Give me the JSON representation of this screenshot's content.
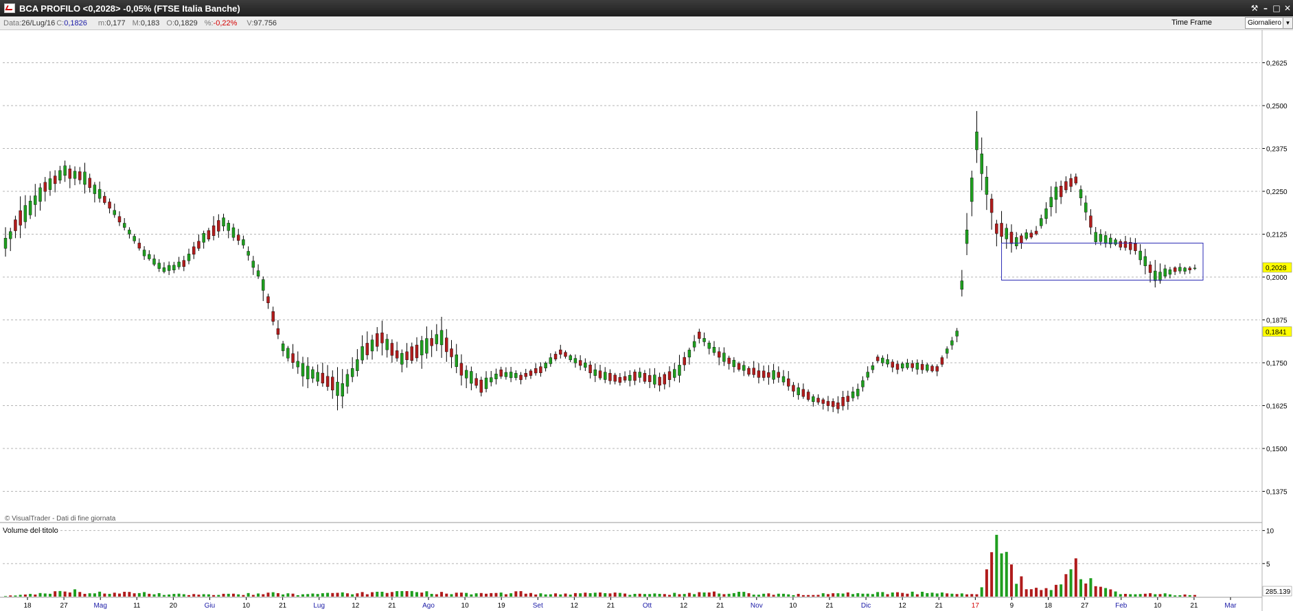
{
  "window": {
    "title": "BCA PROFILO <0,2028> -0,05%  (FTSE Italia Banche)",
    "controls": [
      "tool",
      "minimize",
      "maximize",
      "close"
    ]
  },
  "infobar": {
    "date_label": "Data:",
    "date_value": "26/Lug/16",
    "close_label": "C:",
    "close_value": "0,1826",
    "min_label": "m:",
    "min_value": "0,177",
    "max_label": "M:",
    "max_value": "0,183",
    "open_label": "O:",
    "open_value": "0,1829",
    "pct_label": "%:",
    "pct_value": "-0,22%",
    "vol_label": "V:",
    "vol_value": "97.756",
    "timeframe_label": "Time Frame",
    "timeframe_value": "Giornaliero"
  },
  "colors": {
    "up": "#1f9e1f",
    "down": "#b01c1c",
    "wick": "#000000",
    "grid": "#b4b4b4",
    "highlight_box": "#2a2ab4",
    "price_tag": "#ffff00",
    "month_label": "#1a1aa6",
    "highlight_label": "#d40000"
  },
  "chart": {
    "watermark": "© VisualTrader - Dati di fine giornata",
    "volume_title": "Volume del titolo",
    "price_axis": [
      "0,2625",
      "0,2500",
      "0,2375",
      "0,2250",
      "0,2125",
      "0,2000",
      "0,1875",
      "0,1750",
      "0,1625",
      "0,1500",
      "0,1375"
    ],
    "volume_axis": [
      "10",
      "5"
    ],
    "volume_value_tag": "285.139",
    "last_price_tag": "0,2028",
    "second_price_tag": "0,1841"
  },
  "chart_data": {
    "type": "candlestick",
    "symbol": "BCA PROFILO",
    "ylim": [
      0.13,
      0.27
    ],
    "volume_ylim": [
      0,
      11
    ],
    "x_ticks": [
      {
        "label": "18",
        "kind": "day"
      },
      {
        "label": "27",
        "kind": "day"
      },
      {
        "label": "Mag",
        "kind": "month"
      },
      {
        "label": "11",
        "kind": "day"
      },
      {
        "label": "20",
        "kind": "day"
      },
      {
        "label": "Giu",
        "kind": "month"
      },
      {
        "label": "10",
        "kind": "day"
      },
      {
        "label": "21",
        "kind": "day"
      },
      {
        "label": "Lug",
        "kind": "month"
      },
      {
        "label": "12",
        "kind": "day"
      },
      {
        "label": "21",
        "kind": "day"
      },
      {
        "label": "Ago",
        "kind": "month"
      },
      {
        "label": "10",
        "kind": "day"
      },
      {
        "label": "19",
        "kind": "day"
      },
      {
        "label": "Set",
        "kind": "month"
      },
      {
        "label": "12",
        "kind": "day"
      },
      {
        "label": "21",
        "kind": "day"
      },
      {
        "label": "Ott",
        "kind": "month"
      },
      {
        "label": "12",
        "kind": "day"
      },
      {
        "label": "21",
        "kind": "day"
      },
      {
        "label": "Nov",
        "kind": "month"
      },
      {
        "label": "10",
        "kind": "day"
      },
      {
        "label": "21",
        "kind": "day"
      },
      {
        "label": "Dic",
        "kind": "month"
      },
      {
        "label": "12",
        "kind": "day"
      },
      {
        "label": "21",
        "kind": "day"
      },
      {
        "label": "17",
        "kind": "highlight"
      },
      {
        "label": "9",
        "kind": "day"
      },
      {
        "label": "18",
        "kind": "day"
      },
      {
        "label": "27",
        "kind": "day"
      },
      {
        "label": "Feb",
        "kind": "month"
      },
      {
        "label": "10",
        "kind": "day"
      },
      {
        "label": "21",
        "kind": "day"
      },
      {
        "label": "Mar",
        "kind": "month"
      }
    ],
    "anchors": [
      [
        0.208,
        0.212
      ],
      [
        0.216,
        0.222
      ],
      [
        0.224,
        0.228
      ],
      [
        0.229,
        0.233
      ],
      [
        0.227,
        0.231
      ],
      [
        0.221,
        0.224
      ],
      [
        0.214,
        0.216
      ],
      [
        0.206,
        0.208
      ],
      [
        0.201,
        0.203
      ],
      [
        0.203,
        0.205
      ],
      [
        0.21,
        0.213
      ],
      [
        0.214,
        0.218
      ],
      [
        0.209,
        0.211
      ],
      [
        0.196,
        0.2
      ],
      [
        0.178,
        0.181
      ],
      [
        0.171,
        0.175
      ],
      [
        0.168,
        0.172
      ],
      [
        0.164,
        0.17
      ],
      [
        0.175,
        0.18
      ],
      [
        0.18,
        0.185
      ],
      [
        0.174,
        0.178
      ],
      [
        0.177,
        0.182
      ],
      [
        0.18,
        0.185
      ],
      [
        0.171,
        0.175
      ],
      [
        0.166,
        0.17
      ],
      [
        0.171,
        0.173
      ],
      [
        0.17,
        0.172
      ],
      [
        0.172,
        0.174
      ],
      [
        0.177,
        0.179
      ],
      [
        0.174,
        0.176
      ],
      [
        0.17,
        0.173
      ],
      [
        0.169,
        0.171
      ],
      [
        0.17,
        0.173
      ],
      [
        0.168,
        0.171
      ],
      [
        0.171,
        0.175
      ],
      [
        0.182,
        0.184
      ],
      [
        0.176,
        0.179
      ],
      [
        0.173,
        0.175
      ],
      [
        0.17,
        0.173
      ],
      [
        0.17,
        0.173
      ],
      [
        0.165,
        0.168
      ],
      [
        0.163,
        0.165
      ],
      [
        0.161,
        0.164
      ],
      [
        0.165,
        0.168
      ],
      [
        0.175,
        0.177
      ],
      [
        0.173,
        0.175
      ],
      [
        0.173,
        0.175
      ],
      [
        0.172,
        0.174
      ],
      [
        0.182,
        0.185
      ],
      [
        0.235,
        0.245
      ],
      [
        0.212,
        0.217
      ],
      [
        0.209,
        0.212
      ],
      [
        0.212,
        0.214
      ],
      [
        0.222,
        0.227
      ],
      [
        0.227,
        0.23
      ],
      [
        0.21,
        0.214
      ],
      [
        0.209,
        0.211
      ],
      [
        0.207,
        0.21
      ],
      [
        0.198,
        0.202
      ],
      [
        0.201,
        0.203
      ],
      [
        0.202,
        0.203
      ]
    ],
    "volume_profile": [
      [
        0,
        0.1
      ],
      [
        14,
        0.8
      ],
      [
        15,
        0.5
      ],
      [
        24,
        0.6
      ],
      [
        36,
        0.3
      ],
      [
        48,
        0.4
      ],
      [
        55,
        0.5
      ],
      [
        60,
        0.3
      ],
      [
        68,
        0.5
      ],
      [
        82,
        0.7
      ],
      [
        94,
        0.4
      ],
      [
        104,
        0.6
      ],
      [
        112,
        0.4
      ],
      [
        120,
        0.6
      ],
      [
        126,
        0.3
      ],
      [
        134,
        0.4
      ],
      [
        143,
        0.6
      ],
      [
        150,
        0.5
      ],
      [
        155,
        0.4
      ],
      [
        160,
        0.3
      ],
      [
        166,
        0.4
      ],
      [
        173,
        0.5
      ],
      [
        182,
        0.6
      ],
      [
        188,
        0.5
      ],
      [
        196,
        0.4
      ],
      [
        200,
        7.0
      ],
      [
        201,
        9.5
      ],
      [
        202,
        11.0
      ],
      [
        204,
        2.8
      ],
      [
        206,
        1.8
      ],
      [
        208,
        1.3
      ],
      [
        212,
        1.5
      ],
      [
        214,
        3.0
      ],
      [
        216,
        5.8
      ],
      [
        218,
        2.6
      ],
      [
        220,
        1.6
      ],
      [
        224,
        0.6
      ],
      [
        228,
        0.4
      ],
      [
        232,
        0.5
      ],
      [
        236,
        0.3
      ],
      [
        240,
        0.2
      ]
    ],
    "highlight_box": {
      "from_price": 0.1991,
      "to_price": 0.2099
    }
  }
}
